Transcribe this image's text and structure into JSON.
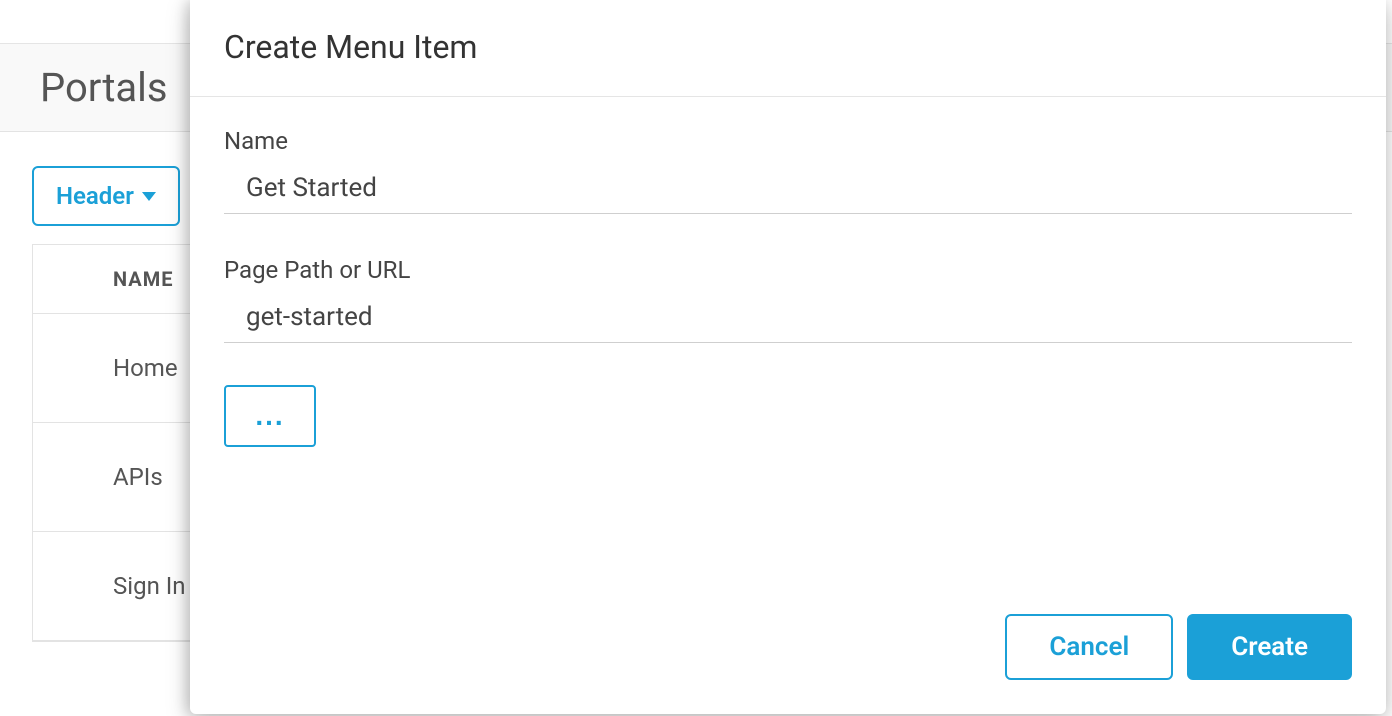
{
  "background": {
    "page_title": "Portals",
    "dropdown_label": "Header",
    "table": {
      "header": "NAME",
      "rows": [
        "Home",
        "APIs",
        "Sign In"
      ]
    }
  },
  "modal": {
    "title": "Create Menu Item",
    "name_label": "Name",
    "name_value": "Get Started",
    "path_label": "Page Path or URL",
    "path_value": "get-started",
    "more_label": "...",
    "cancel_label": "Cancel",
    "create_label": "Create"
  }
}
